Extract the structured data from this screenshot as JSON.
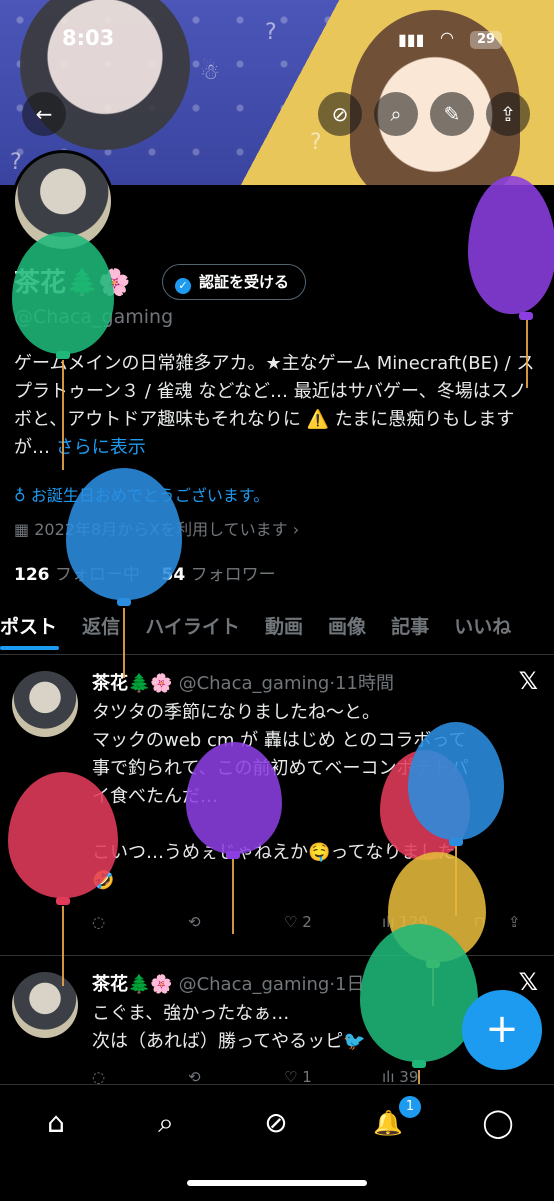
{
  "status_bar": {
    "time": "8:03",
    "battery": "29"
  },
  "profile": {
    "name": "茶花🌲🌸",
    "verify_label": "認証を受ける",
    "handle": "@Chaca_gaming",
    "bio": "ゲームメインの日常雑多アカ。★主なゲーム Minecraft(BE) / スプラトゥーン３ / 雀魂 などなど… 最近はサバゲー、冬場はスノボと、アウトドア趣味もそれなりに ⚠️ たまに愚痴りもしますが…",
    "bio_more": "さらに表示",
    "birthday": "お誕生日おめでとうございます。",
    "joined": "2022年8月からXを利用しています",
    "following_count": "126",
    "following_label": "フォロー中",
    "followers_count": "54",
    "followers_label": "フォロワー"
  },
  "tabs": [
    "ポスト",
    "返信",
    "ハイライト",
    "動画",
    "画像",
    "記事",
    "いいね"
  ],
  "posts": [
    {
      "name": "茶花🌲🌸",
      "handle": "@Chaca_gaming",
      "time": "·11時間",
      "text_lines": [
        "タツタの季節になりましたね〜と。",
        "マックのweb cm が 轟はじめ とのコラボって",
        "事で釣られて、この前初めてベーコンポテトパ",
        "イ食べたんだ…",
        "",
        "こいつ…うめぇじゃねえか🤤ってなりました",
        "🤣"
      ],
      "likes": "2",
      "views": "129"
    },
    {
      "name": "茶花🌲🌸",
      "handle": "@Chaca_gaming",
      "time": "·1日",
      "text_lines": [
        "こぐま、強かったなぁ…",
        "次は（あれば）勝ってやるッピ🐦"
      ],
      "likes": "1",
      "views": "39"
    }
  ],
  "icons": {
    "back": "←",
    "grok": "⊘",
    "search": "⌕",
    "edit": "✎",
    "share": "⇪",
    "x_logo": "𝕏",
    "fab": "+",
    "home": "⌂",
    "nav_search": "⌕",
    "nav_grok": "⊘",
    "bell": "🔔",
    "mail": "◯"
  },
  "notification_badge": "1",
  "colors": {
    "accent": "#1d9bf0",
    "bg": "#000000",
    "muted": "#71767b"
  }
}
